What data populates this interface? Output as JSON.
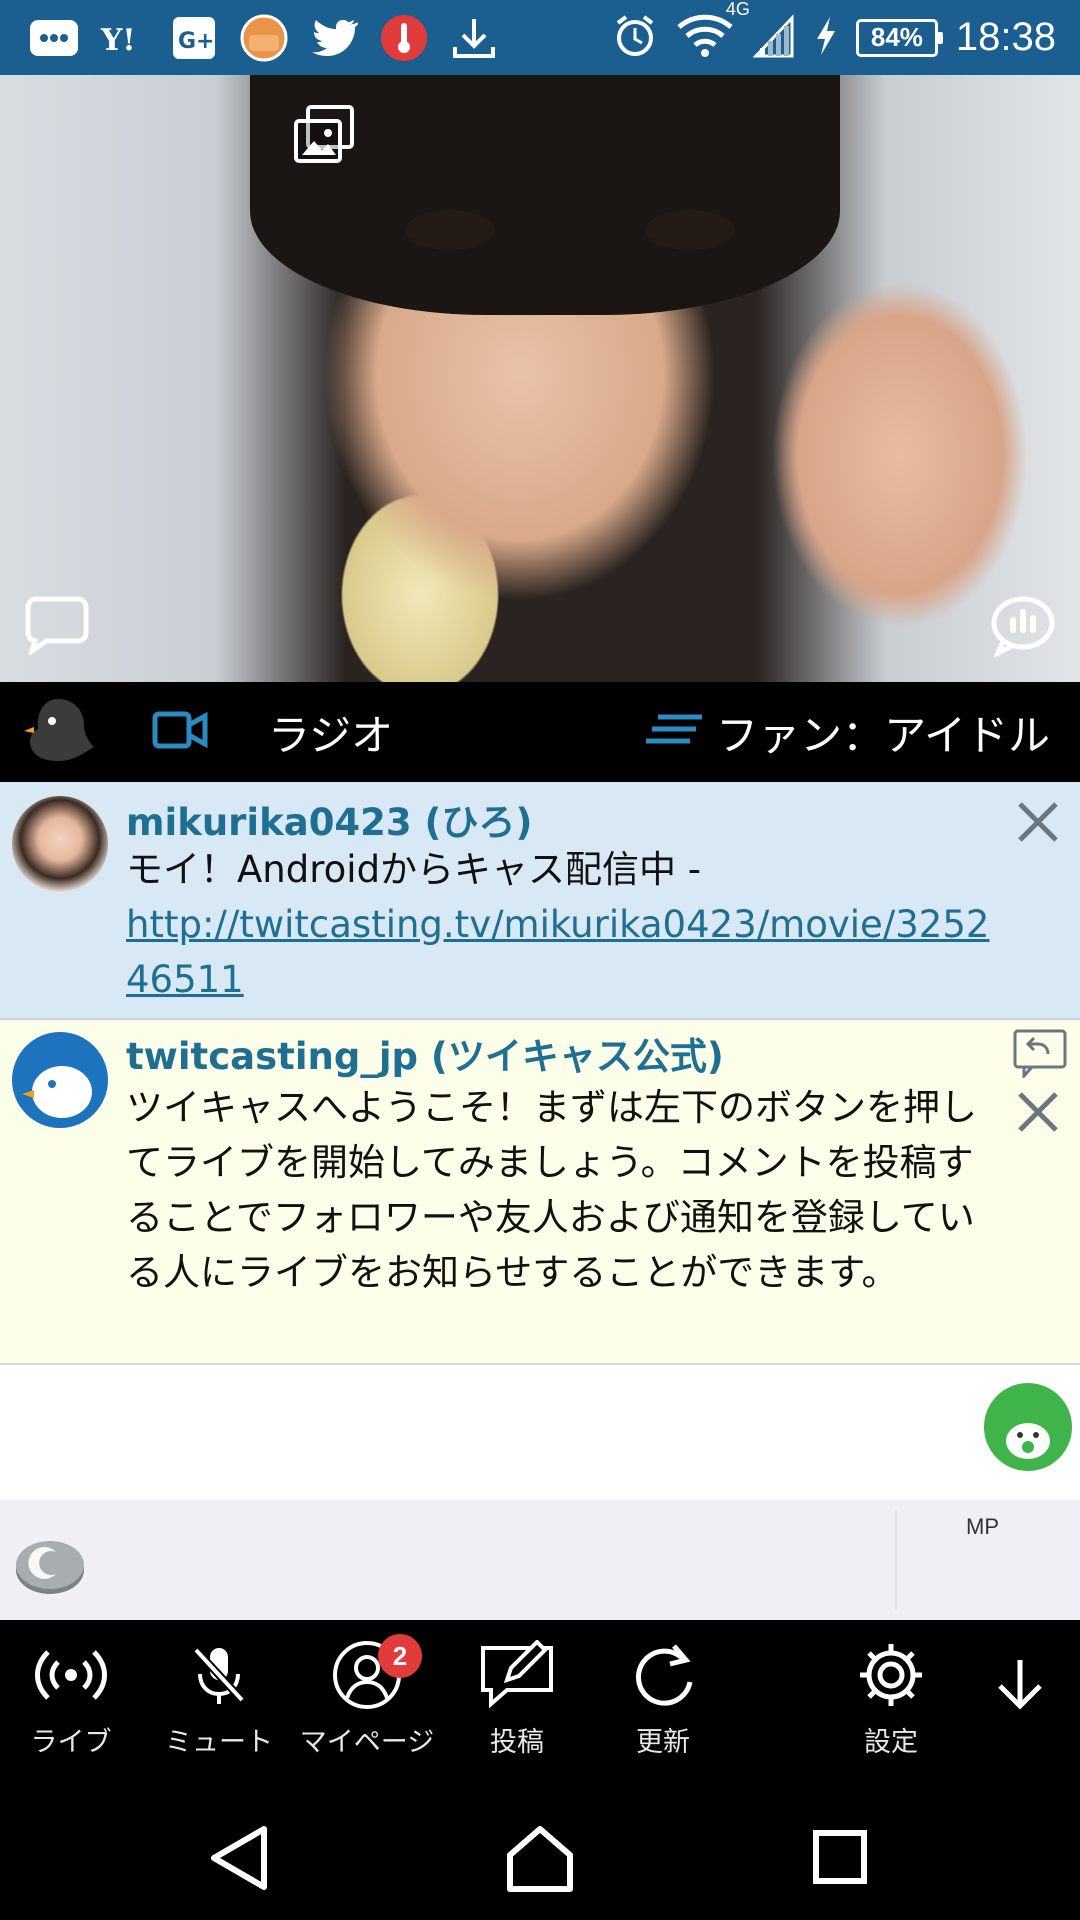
{
  "status_bar": {
    "time": "18:38",
    "battery": "84%",
    "network": "4G"
  },
  "video": {
    "gallery_icon": "gallery-icon",
    "comment_icon": "comment-bubble-icon",
    "stats_icon": "stats-bubble-icon"
  },
  "channel_bar": {
    "mode_label": "ラジオ",
    "category_label": "ファン：アイドル"
  },
  "comments": [
    {
      "name": "mikurika0423 (ひろ)",
      "text": "モイ！Androidからキャス配信中 -",
      "link": "http://twitcasting.tv/mikurika0423/movie/325246511"
    },
    {
      "name": "twitcasting_jp (ツイキャス公式)",
      "text": "ツイキャスへようこそ！まずは左下のボタンを押してライブを開始してみましょう。コメントを投稿することでフォロワーや友人および通知を登録している人にライブをお知らせすることができます。"
    }
  ],
  "input_bar": {
    "mp_label": "MP"
  },
  "toolbar": {
    "items": [
      {
        "label": "ライブ"
      },
      {
        "label": "ミュート"
      },
      {
        "label": "マイページ",
        "badge": "2"
      },
      {
        "label": "投稿"
      },
      {
        "label": "更新"
      },
      {
        "label": "設定"
      }
    ]
  },
  "colors": {
    "status_bar": "#1a5f8f",
    "accent": "#1f6f93",
    "comment1_bg": "#d8e8f5",
    "comment2_bg": "#fdfeea",
    "badge": "#e23b3b"
  }
}
